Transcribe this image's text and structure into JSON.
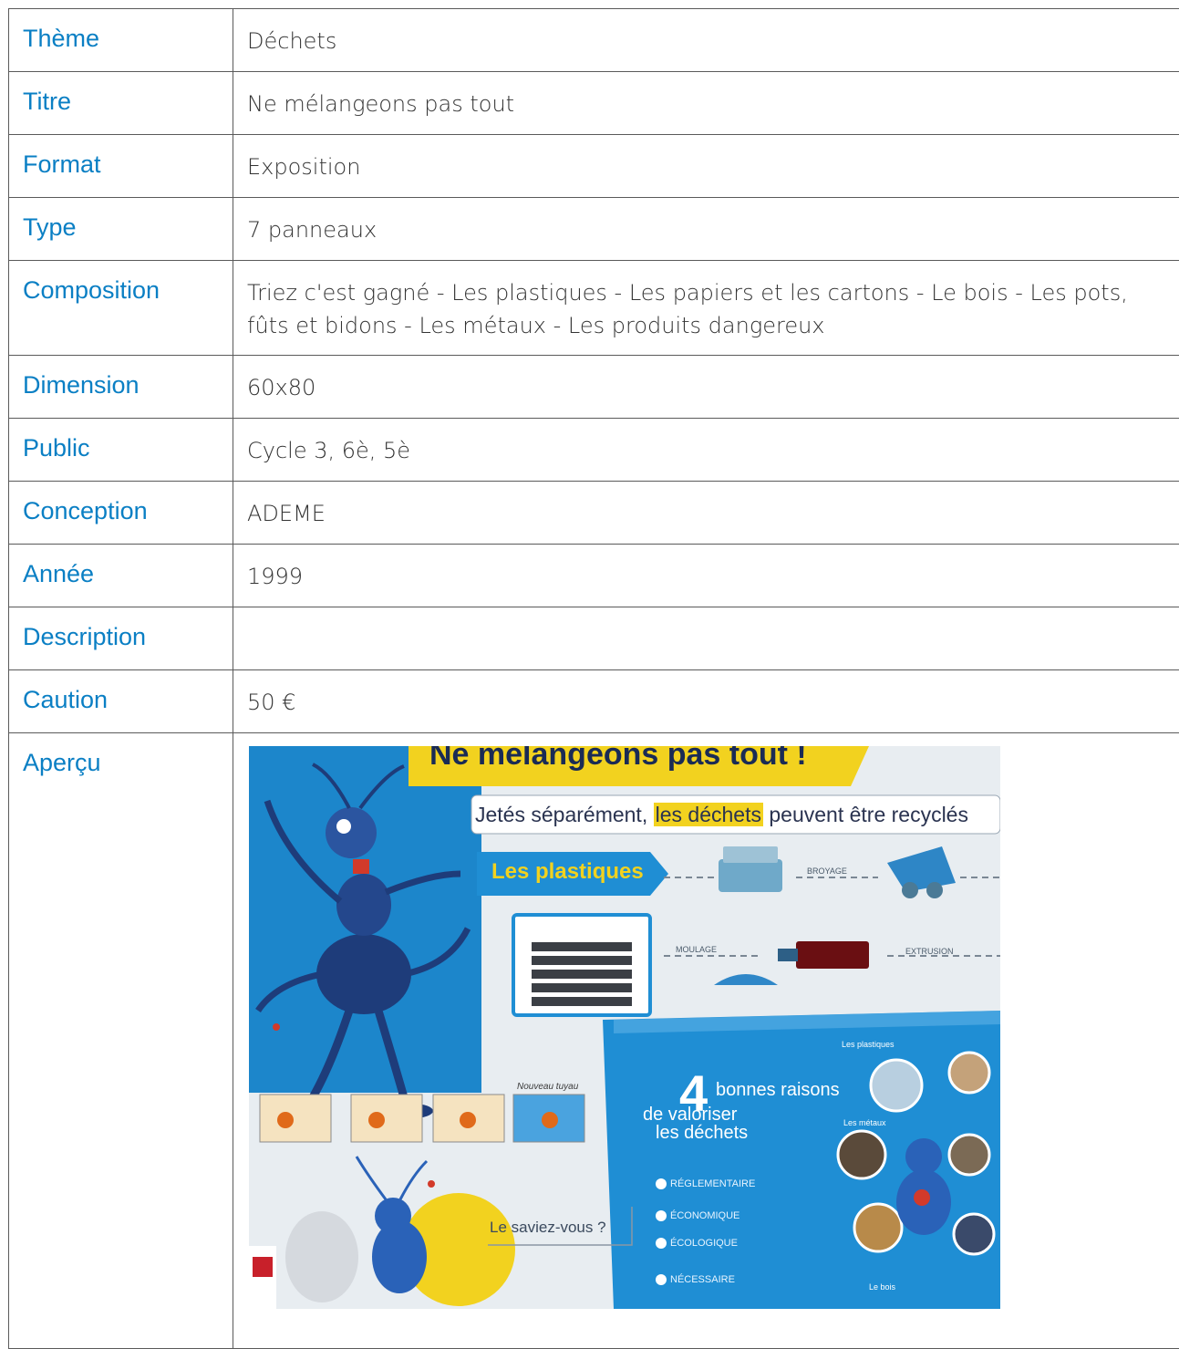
{
  "rows": [
    {
      "label": "Thème",
      "value": "Déchets"
    },
    {
      "label": "Titre",
      "value": "Ne mélangeons pas tout"
    },
    {
      "label": "Format",
      "value": "Exposition"
    },
    {
      "label": "Type",
      "value": "7 panneaux"
    },
    {
      "label": "Composition",
      "value": "Triez c'est gagné - Les plastiques - Les papiers et les cartons - Le bois - Les pots, fûts et bidons - Les métaux - Les produits dangereux"
    },
    {
      "label": "Dimension",
      "value": "60x80"
    },
    {
      "label": "Public",
      "value": "Cycle 3, 6è, 5è"
    },
    {
      "label": "Conception",
      "value": "ADEME"
    },
    {
      "label": "Année",
      "value": "1999"
    },
    {
      "label": "Description",
      "value": ""
    },
    {
      "label": "Caution",
      "value": "50 €"
    },
    {
      "label": "Aperçu",
      "value": ""
    }
  ],
  "poster": {
    "title": "Ne mélangeons pas tout !",
    "subtitle_pre": "Jetés séparément, ",
    "subtitle_highlight": "les déchets",
    "subtitle_post": " peuvent être recyclés",
    "section": "Les plastiques",
    "step_broyage": "BROYAGE",
    "step_moulage": "MOULAGE",
    "step_extrusion": "EXTRUSION",
    "big_number": "4",
    "reasons_line1": "bonnes raisons",
    "reasons_line2": "de valoriser",
    "reasons_line3": "les déchets",
    "reason1": "RÉGLEMENTAIRE",
    "reason2": "ÉCONOMIQUE",
    "reason3": "ÉCOLOGIQUE",
    "reason4": "NÉCESSAIRE",
    "label_plastiques": "Les plastiques",
    "label_metaux": "Les métaux",
    "label_bois": "Le bois",
    "nouveau": "Nouveau tuyau",
    "saviez": "Le saviez-vous ?",
    "colors": {
      "accent_blue": "#1e8fd6",
      "yellow": "#f2d21f",
      "navy": "#1a2b55"
    }
  }
}
